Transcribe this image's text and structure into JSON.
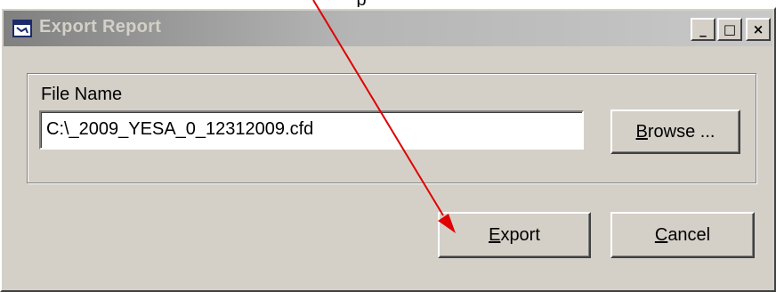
{
  "annotation": {
    "caption_fragment": "p"
  },
  "window": {
    "title": "Export Report",
    "controls": {
      "minimize": "_",
      "maximize": "□",
      "close": "×"
    }
  },
  "file_group": {
    "label": "File Name",
    "path_value": "C:\\_2009_YESA_0_12312009.cfd"
  },
  "buttons": {
    "browse": {
      "mnemonic": "B",
      "rest": "rowse ..."
    },
    "export": {
      "mnemonic": "E",
      "rest": "xport"
    },
    "cancel": {
      "mnemonic": "C",
      "rest": "ancel"
    }
  },
  "colors": {
    "face": "#d4d0c8",
    "annotation_arrow": "#e00000"
  }
}
